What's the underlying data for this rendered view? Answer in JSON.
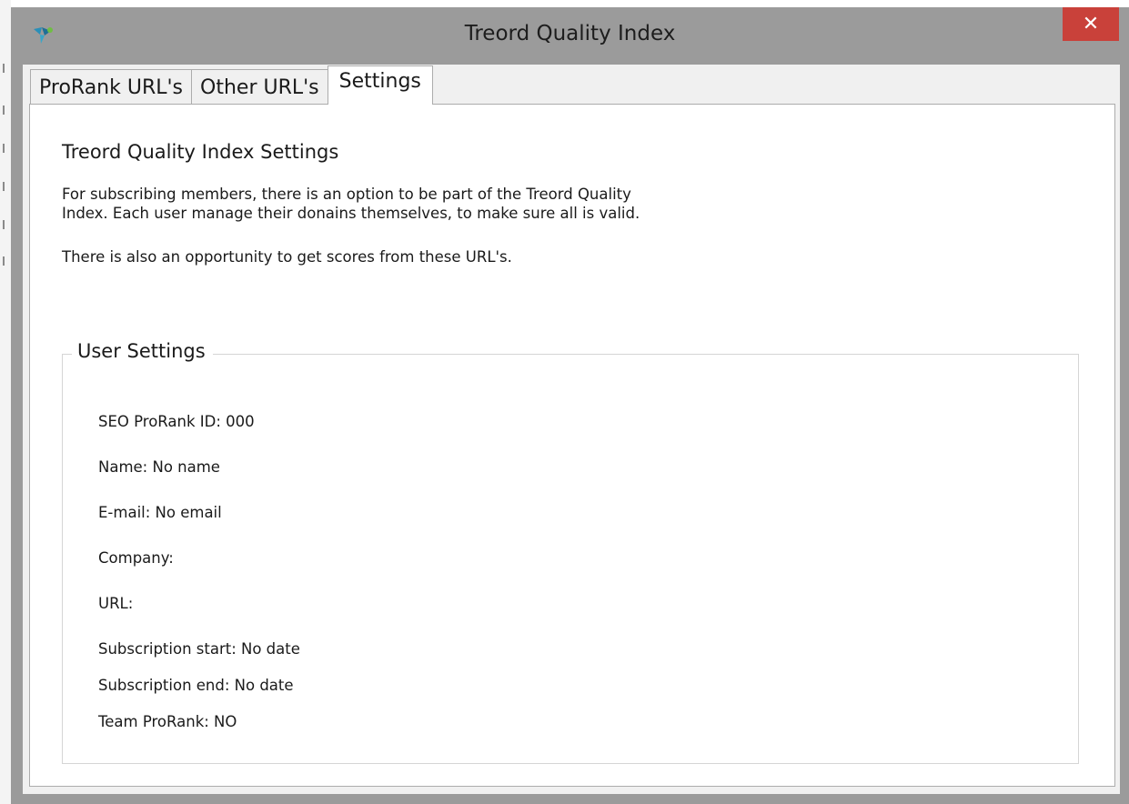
{
  "window": {
    "title": "Treord Quality Index",
    "close_label": "✕",
    "close_color": "#c9413a",
    "icon": "treord-app-icon"
  },
  "tabs": [
    {
      "label": "ProRank URL's",
      "active": false
    },
    {
      "label": "Other URL's",
      "active": false
    },
    {
      "label": "Settings",
      "active": true
    }
  ],
  "settings": {
    "heading": "Treord Quality Index Settings",
    "description_line1": "For subscribing members, there is an option to be part of the Treord Quality",
    "description_line2": "Index. Each user manage their donains themselves, to make sure all is valid.",
    "description_line3": "There is also an opportunity to get scores from these URL's."
  },
  "user_settings": {
    "title": "User Settings",
    "fields": [
      "SEO ProRank ID: 000",
      "Name: No name",
      "E-mail: No email",
      "Company:",
      "URL:",
      "Subscription start: No date",
      "Subscription end: No date",
      "Team ProRank: NO"
    ]
  }
}
